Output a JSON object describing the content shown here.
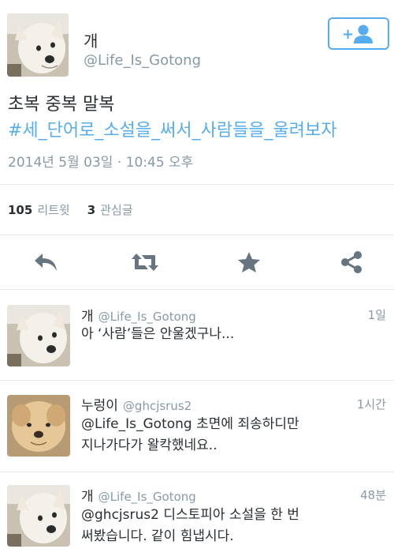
{
  "tweet": {
    "author_name": "개",
    "author_handle": "@Life_Is_Gotong",
    "text_line1": "초복 중복 말복",
    "hashtag": "#세_단어로_소설을_써서_사람들을_울려보자",
    "timestamp": "2014년 5월 03일 · 10:45 오후",
    "follow_icon_text": "+",
    "stats": {
      "retweets_count": "105",
      "retweets_label": "리트윗",
      "favorites_count": "3",
      "favorites_label": "관심글"
    }
  },
  "actions": {
    "icons": [
      "reply-icon",
      "retweet-icon",
      "favorite-icon",
      "share-icon"
    ]
  },
  "replies": [
    {
      "name": "개",
      "handle": "@Life_Is_Gotong",
      "time": "1일",
      "line1": "아 ‘사람’들은 안울겠구나...",
      "line2": ""
    },
    {
      "name": "누렁이",
      "handle": "@ghcjsrus2",
      "time": "1시간",
      "line1": "@Life_Is_Gotong 초면에 죄송하디만",
      "line2": "지나가다가 왈칵했네요.."
    },
    {
      "name": "개",
      "handle": "@Life_Is_Gotong",
      "time": "48분",
      "line1": "@ghcjsrus2 디스토피아 소설을 한 번",
      "line2": "써봤습니다. 같이 힘냅시다."
    }
  ],
  "colors": {
    "accent": "#55acee",
    "muted": "#8899a6",
    "text": "#292f33",
    "divider": "#e1e8ed"
  }
}
